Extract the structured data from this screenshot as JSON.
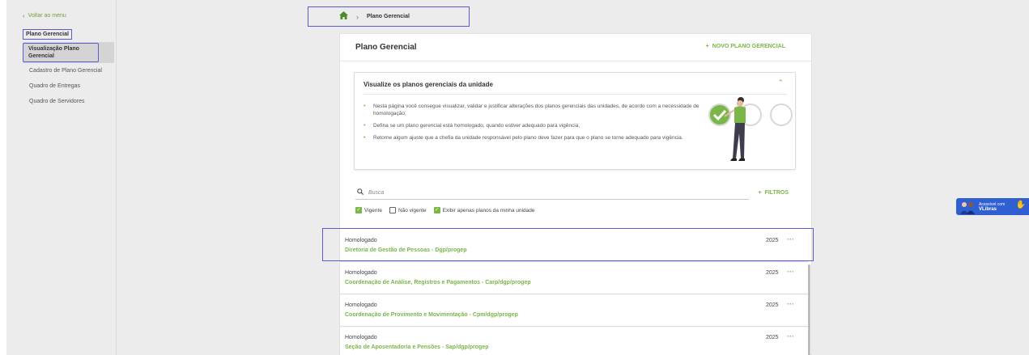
{
  "sidebar": {
    "back_label": "Voltar ao menu",
    "section_title": "Plano Gerencial",
    "active_item": "Visualização Plano Gerencial",
    "items": [
      {
        "label": "Cadastro de Plano Gerencial"
      },
      {
        "label": "Quadro de Entregas"
      },
      {
        "label": "Quadro de Servidores"
      }
    ]
  },
  "breadcrumb": {
    "current": "Plano Gerencial"
  },
  "main": {
    "title": "Plano Gerencial",
    "new_button": "NOVO PLANO GERENCIAL"
  },
  "info": {
    "title": "Visualize os planos gerenciais da unidade",
    "bullets": [
      "Nesta página você consegue visualizar, validar e justificar alterações dos planos gerenciais das unidades, de acordo com a necessidade de homologação;",
      "Defina se um plano gerencial está homologado, quando estiver adequado para vigência;",
      "Retorne algum ajuste que a chefia da unidade responsável pelo plano deve fazer para que o plano se torne adequado para vigência."
    ]
  },
  "search": {
    "placeholder": "Busca",
    "filters_label": "FILTROS"
  },
  "checkboxes": [
    {
      "label": "Vigente",
      "checked": true
    },
    {
      "label": "Não vigente",
      "checked": false
    },
    {
      "label": "Exibir apenas planos da minha unidade",
      "checked": true
    }
  ],
  "plans": [
    {
      "status": "Homologado",
      "name": "Diretoria de Gestão de Pessoas - Dgp/progep",
      "year": "2025"
    },
    {
      "status": "Homologado",
      "name": "Coordenação de Análise, Registros e Pagamentos - Carp/dgp/progep",
      "year": "2025"
    },
    {
      "status": "Homologado",
      "name": "Coordenação de Provimento e Movimentação - Cpm/dgp/progep",
      "year": "2025"
    },
    {
      "status": "Homologado",
      "name": "Seção de Aposentadoria e Pensões - Sap/dgp/progep",
      "year": "2025"
    }
  ],
  "libras": {
    "line1": "Acessível com",
    "line2": "VLibras"
  },
  "colors": {
    "accent": "#7ab648",
    "highlight": "#5b5bd6"
  }
}
